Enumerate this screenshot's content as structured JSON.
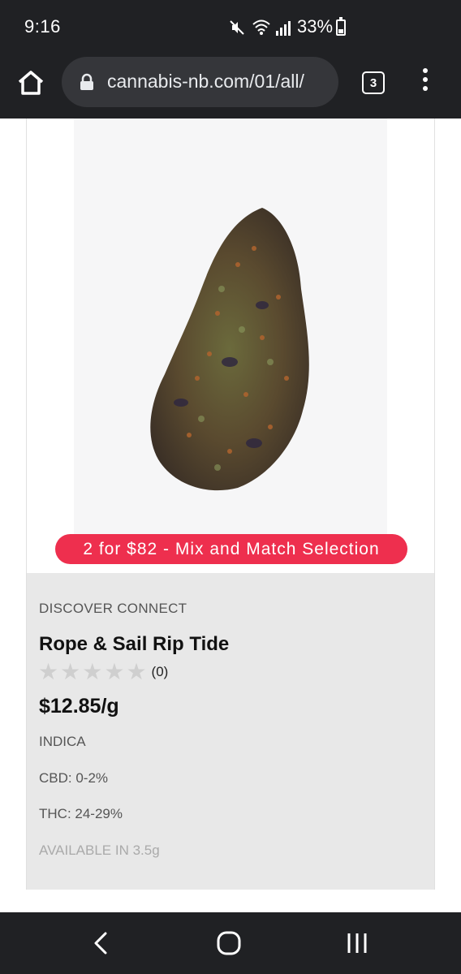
{
  "status_bar": {
    "time": "9:16",
    "battery": "33%",
    "icons": [
      "mute-icon",
      "wifi-icon",
      "signal-icon",
      "battery-icon"
    ]
  },
  "browser": {
    "url": "cannabis-nb.com/01/all/",
    "tab_count": "3"
  },
  "product": {
    "promo": "2 for $82 - Mix and Match Selection",
    "brand": "DISCOVER CONNECT",
    "name": "Rope & Sail Rip Tide",
    "rating_count": "(0)",
    "rating": 0,
    "price": "$12.85/g",
    "type": "INDICA",
    "cbd": "CBD: 0-2%",
    "thc": "THC: 24-29%",
    "availability": "AVAILABLE IN 3.5g"
  },
  "colors": {
    "chrome_dark": "#202124",
    "url_bar": "#35363a",
    "promo_red": "#ee2f4e",
    "info_bg": "#e8e8e8"
  }
}
